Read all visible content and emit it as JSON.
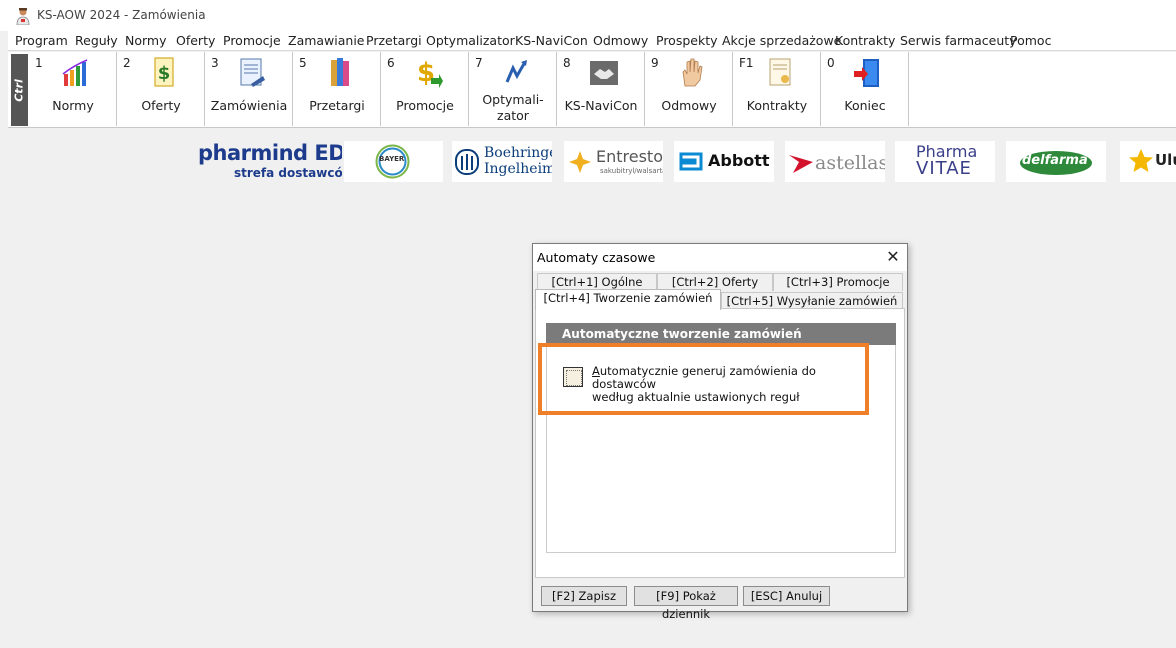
{
  "window": {
    "title": "KS-AOW 2024 - Zamówienia"
  },
  "menu": [
    "Program",
    "Reguły",
    "Normy",
    "Oferty",
    "Promocje",
    "Zamawianie",
    "Przetargi",
    "Optymalizator",
    "KS-NaviCon",
    "Odmowy",
    "Prospekty",
    "Akcje sprzedażowe",
    "Kontrakty",
    "Serwis farmaceuty",
    "Pomoc"
  ],
  "toolbar": {
    "ctrl_label": "Ctrl",
    "buttons": [
      {
        "key": "1",
        "label": "Normy",
        "icon": "bar-chart-icon"
      },
      {
        "key": "2",
        "label": "Oferty",
        "icon": "dollar-document-icon"
      },
      {
        "key": "3",
        "label": "Zamówienia",
        "icon": "order-list-icon"
      },
      {
        "key": "5",
        "label": "Przetargi",
        "icon": "binders-icon"
      },
      {
        "key": "6",
        "label": "Promocje",
        "icon": "dollar-arrow-icon"
      },
      {
        "key": "7",
        "label": "Optymali-\nzator",
        "icon": "optimizer-icon"
      },
      {
        "key": "8",
        "label": "KS-NaviCon",
        "icon": "handshake-icon"
      },
      {
        "key": "9",
        "label": "Odmowy",
        "icon": "hand-icon"
      },
      {
        "key": "F1",
        "label": "Kontrakty",
        "icon": "certificate-icon"
      },
      {
        "key": "0",
        "label": "Koniec",
        "icon": "exit-door-icon"
      }
    ]
  },
  "logos": {
    "pharmind_main": "pharmind EDI",
    "pharmind_sub": "strefa dostawców",
    "bayer": "BAYER",
    "boehringer_1": "Boehringer",
    "boehringer_2": "Ingelheim",
    "entresto": "Entresto",
    "entresto_sub": "sakubitryl/walsartan",
    "abbott": "Abbott",
    "astellas": "astellas",
    "pharmavitae_1": "Pharma",
    "pharmavitae_2": "VITAE",
    "delfarma": "delfarma",
    "ulubione": "Ulu"
  },
  "dialog": {
    "title": "Automaty czasowe",
    "tabs_row1": [
      "[Ctrl+1] Ogólne",
      "[Ctrl+2] Oferty",
      "[Ctrl+3] Promocje"
    ],
    "tabs_row2": [
      "[Ctrl+4] Tworzenie zamówień",
      "[Ctrl+5] Wysyłanie zamówień"
    ],
    "active_tab": "[Ctrl+4] Tworzenie zamówień",
    "section_header": "Automatyczne tworzenie zamówień",
    "checkbox_label_first": "A",
    "checkbox_label_rest": "utomatycznie generuj zamówienia do dostawców",
    "checkbox_label_line2": "według aktualnie ustawionych reguł",
    "checkbox_checked": false,
    "buttons": {
      "save": "[F2] Zapisz",
      "log": "[F9] Pokaż dziennik",
      "cancel": "[ESC] Anuluj"
    },
    "highlight_color": "#f07f2a"
  }
}
